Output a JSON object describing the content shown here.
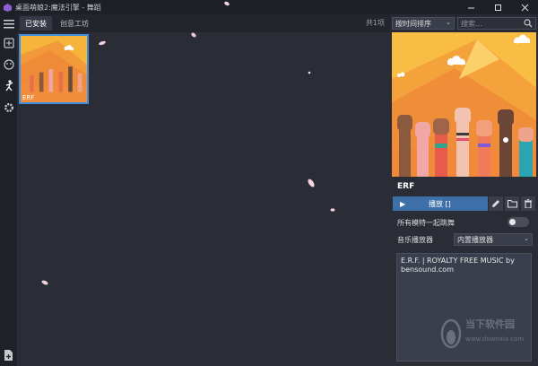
{
  "window": {
    "title": "桌面萌娘2:魔法引擎 - 舞蹈",
    "buttons": [
      "minimize",
      "maximize",
      "close"
    ]
  },
  "leftbar": {
    "icons": [
      "menu-icon",
      "import-icon",
      "face-icon",
      "dance-icon",
      "settings-icon",
      "add-file-icon"
    ]
  },
  "tabs": [
    {
      "label": "已安装",
      "active": true
    },
    {
      "label": "创意工坊",
      "active": false
    }
  ],
  "count_text": "共1项",
  "sort": {
    "selected": "按时间排序"
  },
  "search": {
    "placeholder": "搜索..."
  },
  "items": [
    {
      "label": "ERF",
      "selected": true
    }
  ],
  "detail": {
    "name": "ERF",
    "play_label": "播放 []",
    "dance_together_label": "所有模特一起跳舞",
    "dance_together_on": false,
    "music_player_label": "音乐播放器",
    "music_player_selected": "内置播放器",
    "description": "E.R.F. | ROYALTY FREE MUSIC by bensound.com"
  },
  "watermark": {
    "text": "当下软件园",
    "url": "www.downxia.com"
  },
  "colors": {
    "accent": "#3d6fa8",
    "selection": "#3f8fe0",
    "background": "#272a33",
    "artwork": "#f7b73b"
  }
}
